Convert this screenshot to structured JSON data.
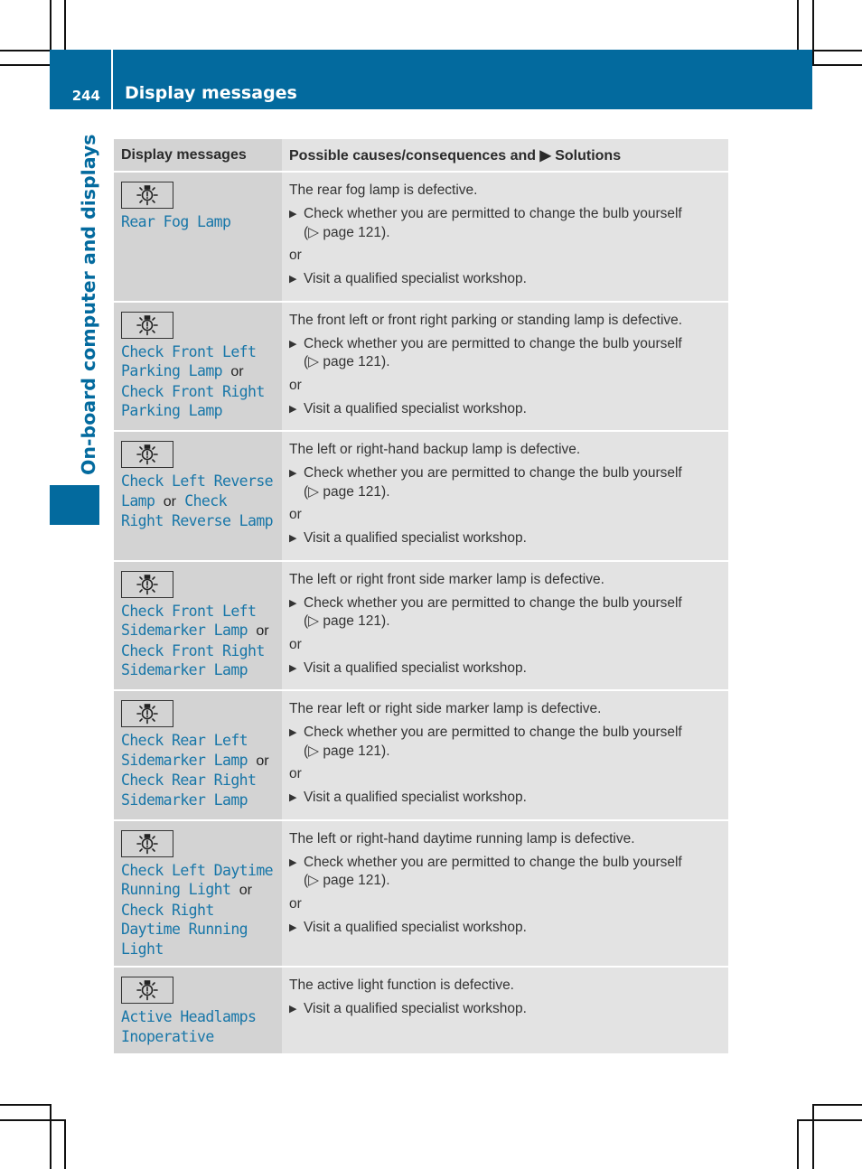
{
  "page": {
    "number": "244",
    "section_title": "Display messages",
    "chapter_tab": "On-board computer and displays"
  },
  "table": {
    "headers": {
      "display_messages": "Display messages",
      "causes": "Possible causes/consequences and ▶ Solutions"
    },
    "icon": "bulb-warning-icon",
    "or_word": "or",
    "triangle": "▶",
    "rows": [
      {
        "message_parts": [
          "Rear Fog Lamp"
        ],
        "cause": "The rear fog lamp is defective.",
        "steps": [
          {
            "text": "Check whether you are permitted to change the bulb yourself",
            "ref": "(▷ page 121)."
          },
          {
            "or": true
          },
          {
            "text": "Visit a qualified specialist workshop."
          }
        ]
      },
      {
        "message_parts": [
          "Check Front Left Parking Lamp",
          "Check Front Right Parking Lamp"
        ],
        "cause": "The front left or front right parking or standing lamp is defective.",
        "steps": [
          {
            "text": "Check whether you are permitted to change the bulb yourself",
            "ref": "(▷ page 121)."
          },
          {
            "or": true
          },
          {
            "text": "Visit a qualified specialist workshop."
          }
        ]
      },
      {
        "message_parts": [
          "Check Left Reverse Lamp",
          "Check Right Reverse Lamp"
        ],
        "cause": "The left or right-hand backup lamp is defective.",
        "steps": [
          {
            "text": "Check whether you are permitted to change the bulb yourself",
            "ref": "(▷ page 121)."
          },
          {
            "or": true
          },
          {
            "text": "Visit a qualified specialist workshop."
          }
        ]
      },
      {
        "message_parts": [
          "Check Front Left Sidemarker Lamp",
          "Check Front Right Sidemarker Lamp"
        ],
        "cause": "The left or right front side marker lamp is defective.",
        "steps": [
          {
            "text": "Check whether you are permitted to change the bulb yourself",
            "ref": "(▷ page 121)."
          },
          {
            "or": true
          },
          {
            "text": "Visit a qualified specialist workshop."
          }
        ]
      },
      {
        "message_parts": [
          "Check Rear Left Sidemarker Lamp",
          "Check Rear Right Sidemarker Lamp"
        ],
        "cause": "The rear left or right side marker lamp is defective.",
        "steps": [
          {
            "text": "Check whether you are permitted to change the bulb yourself",
            "ref": "(▷ page 121)."
          },
          {
            "or": true
          },
          {
            "text": "Visit a qualified specialist workshop."
          }
        ]
      },
      {
        "message_parts": [
          "Check Left Daytime Running Light",
          "Check Right Daytime Running Light"
        ],
        "cause": "The left or right-hand daytime running lamp is defective.",
        "steps": [
          {
            "text": "Check whether you are permitted to change the bulb yourself",
            "ref": "(▷ page 121)."
          },
          {
            "or": true
          },
          {
            "text": "Visit a qualified specialist workshop."
          }
        ]
      },
      {
        "message_parts": [
          "Active Headlamps Inoperative"
        ],
        "cause": "The active light function is defective.",
        "steps": [
          {
            "text": "Visit a qualified specialist workshop."
          }
        ]
      }
    ]
  }
}
